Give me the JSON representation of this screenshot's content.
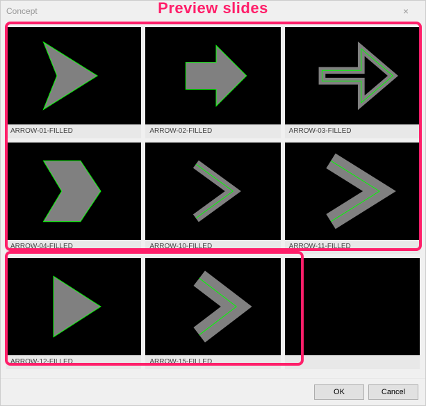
{
  "window": {
    "title": "Concept",
    "close": "×"
  },
  "annotation": {
    "label": "Preview slides"
  },
  "tiles": [
    {
      "label": "ARROW-01-FILLED",
      "icon": "arrow-01"
    },
    {
      "label": "ARROW-02-FILLED",
      "icon": "arrow-02"
    },
    {
      "label": "ARROW-03-FILLED",
      "icon": "arrow-03"
    },
    {
      "label": "ARROW-04-FILLED",
      "icon": "arrow-04"
    },
    {
      "label": "ARROW-10-FILLED",
      "icon": "arrow-10"
    },
    {
      "label": "ARROW-11-FILLED",
      "icon": "arrow-11"
    },
    {
      "label": "ARROW-12-FILLED",
      "icon": "arrow-12"
    },
    {
      "label": "ARROW-15-FILLED",
      "icon": "arrow-15"
    }
  ],
  "empty_slots": 1,
  "buttons": {
    "ok": "OK",
    "cancel": "Cancel"
  },
  "colors": {
    "thumb_bg": "#000000",
    "arrow_fill": "#808080",
    "arrow_stroke": "#00ff00",
    "annotation": "#ff1f6a"
  }
}
